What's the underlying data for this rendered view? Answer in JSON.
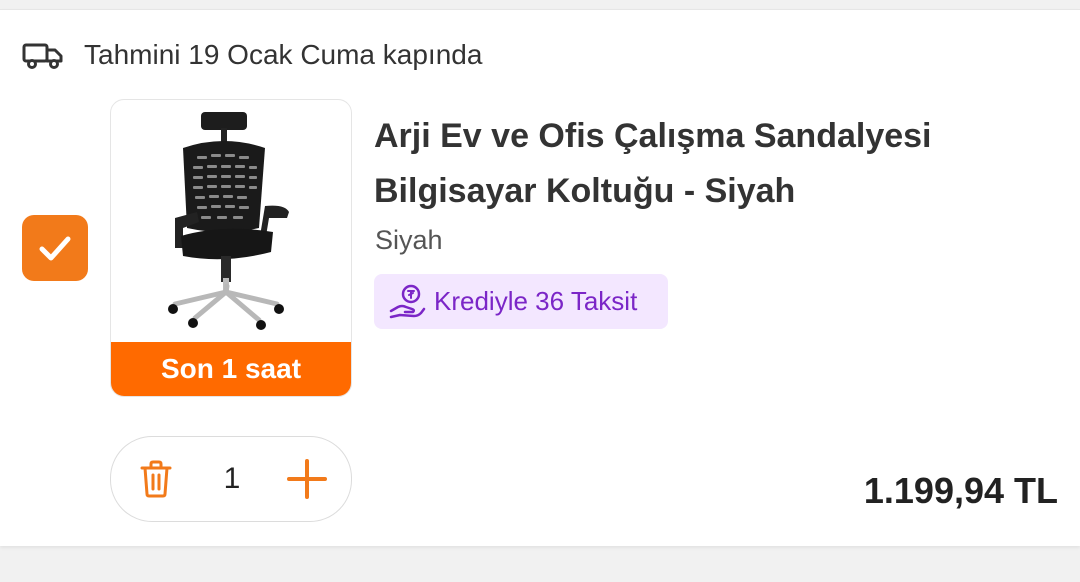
{
  "delivery": {
    "icon": "truck-icon",
    "text": "Tahmini 19 Ocak Cuma kapında"
  },
  "item": {
    "checked": true,
    "image_icon": "office-chair-image",
    "badge": "Son 1 saat",
    "title_line1": "Arji Ev ve Ofis Çalışma Sandalyesi",
    "title_line2": "Bilgisayar Koltuğu - Siyah",
    "variant": "Siyah",
    "credit": {
      "icon": "coin-hand-icon",
      "text": "Krediyle 36 Taksit"
    },
    "quantity": "1",
    "price": "1.199,94 TL"
  },
  "colors": {
    "accent": "#f27a1a",
    "badge": "#ff6a00",
    "credit_bg": "#f3e7ff",
    "credit_text": "#7b26c7"
  }
}
